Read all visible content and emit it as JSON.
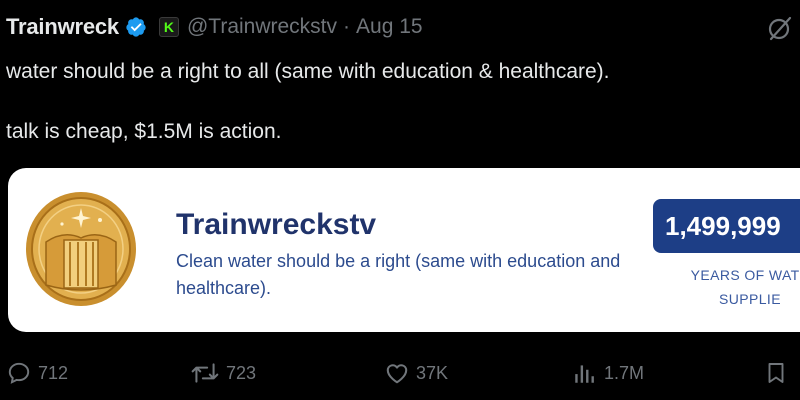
{
  "tweet": {
    "display_name": "Trainwreck",
    "handle": "@Trainwreckstv",
    "separator": "·",
    "date": "Aug 15",
    "verified_icon": "verified-badge-icon",
    "kick_icon": "kick-logo-icon",
    "kick_letter": "K",
    "text_line1": "water should be a right to all (same with education & healthcare).",
    "text_line2": "talk is cheap, $1.5M is action."
  },
  "card": {
    "title": "Trainwreckstv",
    "description": "Clean water should be a right (same with education and healthcare).",
    "counter_value": "1,499,999",
    "counter_label_line1": "YEARS OF WATE",
    "counter_label_line2": "SUPPLIE"
  },
  "actions": {
    "replies": "712",
    "retweets": "723",
    "likes": "37K",
    "views": "1.7M"
  },
  "colors": {
    "background": "#000000",
    "verified": "#1d9bf0",
    "kick": "#53fc18",
    "card_title": "#20336b",
    "counter_box": "#1d3e86",
    "gold": "#d9a441"
  }
}
